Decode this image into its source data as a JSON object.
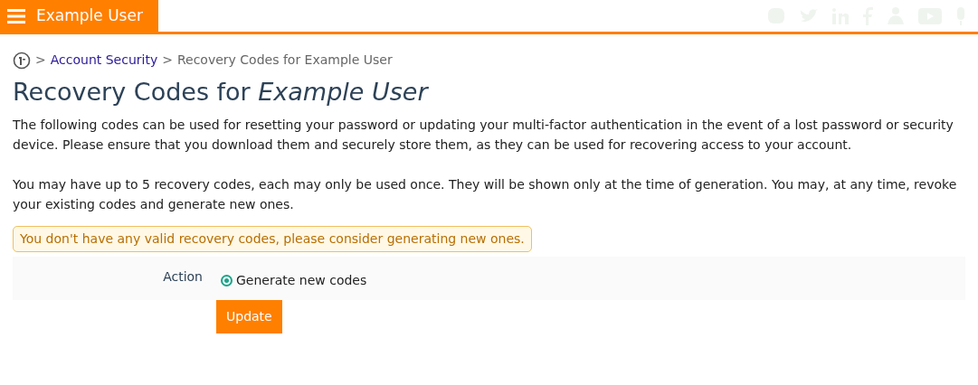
{
  "header": {
    "title": "Example User"
  },
  "breadcrumb": [
    {
      "separator": ">",
      "text": "Account Security",
      "link": true
    },
    {
      "separator": ">",
      "text": "Recovery Codes for Example User",
      "link": false
    }
  ],
  "heading": "Recovery Codes for *Example User*",
  "paragraphs": [
    "The following codes can be used for resetting your password or updating your multi-factor authentication in the event of a lost password or security device. Please ensure that you download them and securely store them, as they can be used for recovering access to your account.",
    "You may have up to 5 recovery codes, each may only be used once. They will be shown only at the time of generation. You may, at any time, revoke your existing codes and generate new ones."
  ],
  "warning": "You don't have any valid recovery codes, please consider generating new ones.",
  "form": {
    "label": "Action",
    "options": [
      {
        "label": "Generate new codes",
        "selected": true
      }
    ]
  },
  "button": "Update"
}
